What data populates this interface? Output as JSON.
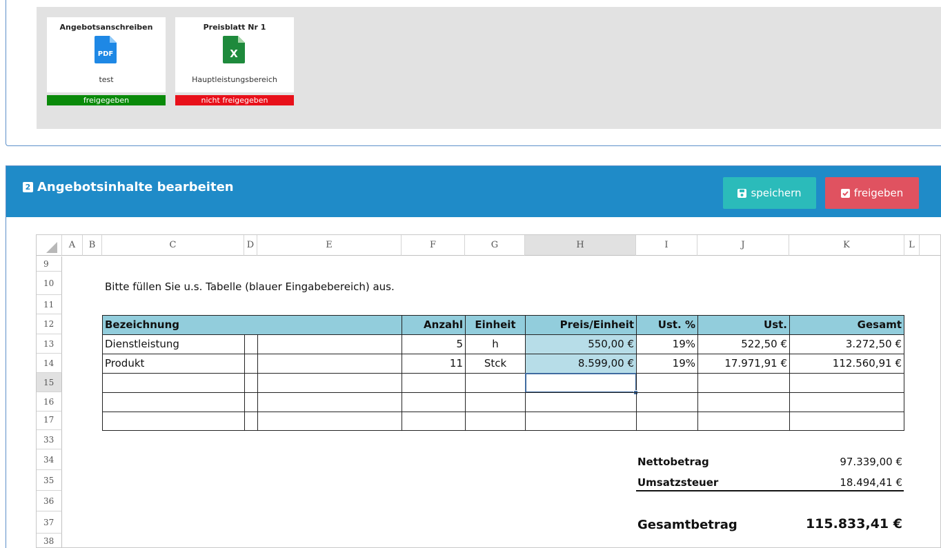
{
  "documents": [
    {
      "title": "Angebotsanschreiben",
      "icon": "pdf-file-icon",
      "icon_label": "PDF",
      "subtitle": "test",
      "status": "freigegeben",
      "status_color": "#0a8a0a"
    },
    {
      "title": "Preisblatt Nr 1",
      "icon": "excel-file-icon",
      "icon_label": "X",
      "subtitle": "Hauptleistungsbereich",
      "status": "nicht freigegeben",
      "status_color": "#e8101a"
    }
  ],
  "panel": {
    "number": "2",
    "title": "Angebotsinhalte bearbeiten",
    "save_label": "speichern",
    "release_label": "freigeben"
  },
  "sheet": {
    "columns": [
      "A",
      "B",
      "C",
      "D",
      "E",
      "F",
      "G",
      "H",
      "I",
      "J",
      "K",
      "L"
    ],
    "rows": [
      "9",
      "10",
      "11",
      "12",
      "13",
      "14",
      "15",
      "16",
      "17",
      "33",
      "34",
      "35",
      "36",
      "37",
      "38"
    ],
    "instruction": "Bitte füllen Sie u.s. Tabelle (blauer Eingabebereich) aus.",
    "headers": {
      "bezeichnung": "Bezeichnung",
      "anzahl": "Anzahl",
      "einheit": "Einheit",
      "preis": "Preis/Einheit",
      "ust_pct": "Ust. %",
      "ust": "Ust.",
      "gesamt": "Gesamt"
    },
    "items": [
      {
        "bezeichnung": "Dienstleistung",
        "anzahl": "5",
        "einheit": "h",
        "preis": "550,00 €",
        "ust_pct": "19%",
        "ust": "522,50 €",
        "gesamt": "3.272,50 €"
      },
      {
        "bezeichnung": "Produkt",
        "anzahl": "11",
        "einheit": "Stck",
        "preis": "8.599,00 €",
        "ust_pct": "19%",
        "ust": "17.971,91 €",
        "gesamt": "112.560,91 €"
      }
    ],
    "summary": {
      "netto_label": "Nettobetrag",
      "netto_value": "97.339,00 €",
      "ust_label": "Umsatzsteuer",
      "ust_value": "18.494,41 €",
      "gesamt_label": "Gesamtbetrag",
      "gesamt_value": "115.833,41 €"
    }
  }
}
